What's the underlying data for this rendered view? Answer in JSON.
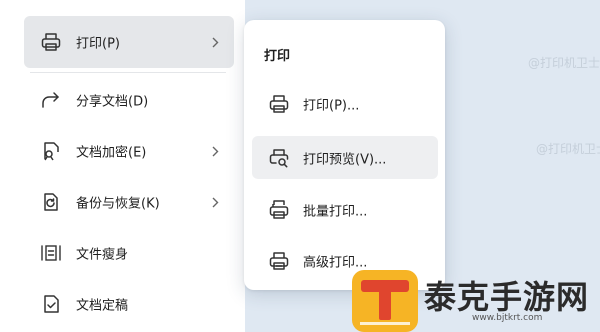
{
  "main_menu": {
    "items": [
      {
        "label": "打印(P)",
        "icon": "printer-icon",
        "has_submenu": true
      },
      {
        "label": "分享文档(D)",
        "icon": "share-icon",
        "has_submenu": false
      },
      {
        "label": "文档加密(E)",
        "icon": "document-lock-icon",
        "has_submenu": true
      },
      {
        "label": "备份与恢复(K)",
        "icon": "backup-restore-icon",
        "has_submenu": true
      },
      {
        "label": "文件瘦身",
        "icon": "compress-file-icon",
        "has_submenu": false
      },
      {
        "label": "文档定稿",
        "icon": "document-finalize-icon",
        "has_submenu": false
      }
    ]
  },
  "submenu": {
    "title": "打印",
    "items": [
      {
        "label": "打印(P)...",
        "icon": "printer-icon"
      },
      {
        "label": "打印预览(V)...",
        "icon": "print-preview-icon"
      },
      {
        "label": "批量打印...",
        "icon": "batch-print-icon"
      },
      {
        "label": "高级打印...",
        "icon": "advanced-print-icon"
      }
    ]
  },
  "watermark": "@打印机卫士",
  "logo": {
    "text": "泰克手游网",
    "url": "www.bjtkrt.com",
    "accent": "#f6b425"
  }
}
